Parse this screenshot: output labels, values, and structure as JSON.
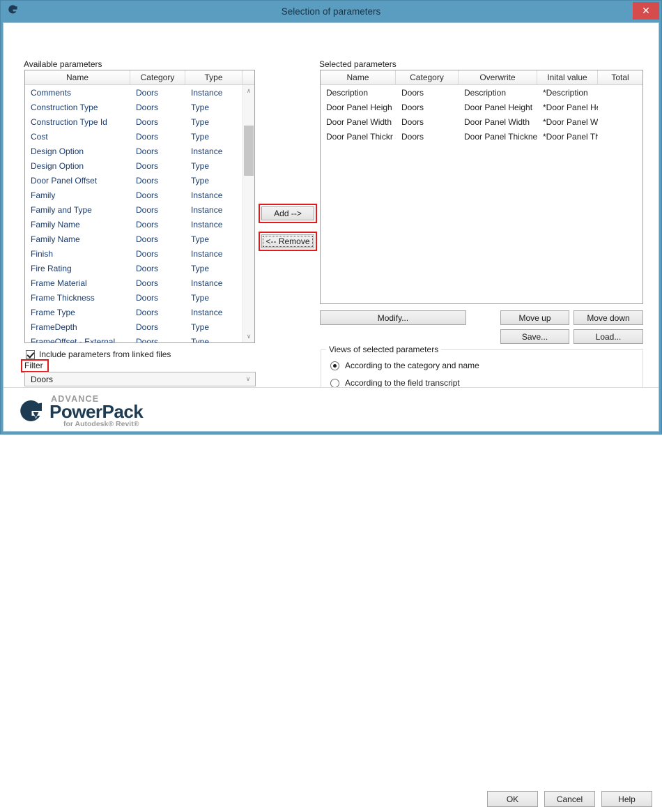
{
  "window": {
    "title": "Selection of parameters",
    "icon": "graitec-g-icon",
    "close_label": "✕",
    "titlebar_color": "#5b9dc0",
    "close_color": "#d64c4c",
    "highlight_color": "#e01b1b"
  },
  "available": {
    "label": "Available parameters",
    "columns": [
      "Name",
      "Category",
      "Type"
    ],
    "rows": [
      {
        "name": "Comments",
        "category": "Doors",
        "type": "Instance"
      },
      {
        "name": "Construction Type",
        "category": "Doors",
        "type": "Type"
      },
      {
        "name": "Construction Type Id",
        "category": "Doors",
        "type": "Type"
      },
      {
        "name": "Cost",
        "category": "Doors",
        "type": "Type"
      },
      {
        "name": "Design Option",
        "category": "Doors",
        "type": "Instance"
      },
      {
        "name": "Design Option",
        "category": "Doors",
        "type": "Type"
      },
      {
        "name": "Door Panel Offset",
        "category": "Doors",
        "type": "Type"
      },
      {
        "name": "Family",
        "category": "Doors",
        "type": "Instance"
      },
      {
        "name": "Family and Type",
        "category": "Doors",
        "type": "Instance"
      },
      {
        "name": "Family Name",
        "category": "Doors",
        "type": "Instance"
      },
      {
        "name": "Family Name",
        "category": "Doors",
        "type": "Type"
      },
      {
        "name": "Finish",
        "category": "Doors",
        "type": "Instance"
      },
      {
        "name": "Fire Rating",
        "category": "Doors",
        "type": "Type"
      },
      {
        "name": "Frame Material",
        "category": "Doors",
        "type": "Instance"
      },
      {
        "name": "Frame Thickness",
        "category": "Doors",
        "type": "Type"
      },
      {
        "name": "Frame Type",
        "category": "Doors",
        "type": "Instance"
      },
      {
        "name": "FrameDepth",
        "category": "Doors",
        "type": "Type"
      },
      {
        "name": "FrameOffset - External",
        "category": "Doors",
        "type": "Type"
      }
    ],
    "scroll_up_glyph": "∧",
    "scroll_down_glyph": "∨"
  },
  "selected": {
    "label": "Selected parameters",
    "columns": [
      "Name",
      "Category",
      "Overwrite",
      "Inital value",
      "Total"
    ],
    "rows": [
      {
        "name": "Description",
        "category": "Doors",
        "overwrite": "Description",
        "initial": "*Description",
        "total": ""
      },
      {
        "name": "Door Panel Heigh",
        "category": "Doors",
        "overwrite": "Door Panel Height",
        "initial": "*Door Panel He",
        "total": ""
      },
      {
        "name": "Door Panel Width",
        "category": "Doors",
        "overwrite": "Door Panel Width",
        "initial": "*Door Panel W",
        "total": ""
      },
      {
        "name": "Door Panel Thickr",
        "category": "Doors",
        "overwrite": "Door Panel Thickne",
        "initial": "*Door Panel Th",
        "total": ""
      }
    ]
  },
  "transfer": {
    "add_label": "Add -->",
    "remove_label": "<-- Remove"
  },
  "filter": {
    "include_linked_label": "Include parameters from linked files",
    "include_linked_checked": true,
    "filter_label": "Filter",
    "selected_value": "Doors",
    "dropdown_glyph": "∨"
  },
  "actions": {
    "modify_label": "Modify...",
    "move_up_label": "Move up",
    "move_down_label": "Move down",
    "save_label": "Save...",
    "load_label": "Load..."
  },
  "views_group": {
    "title": "Views of selected parameters",
    "options": [
      {
        "label": "According to the category and name",
        "selected": true
      },
      {
        "label": "According to the field transcript",
        "selected": false
      }
    ]
  },
  "branding": {
    "advance": "ADVANCE",
    "product": "PowerPack",
    "subtitle": "for Autodesk® Revit®"
  },
  "dialog_buttons": {
    "ok": "OK",
    "cancel": "Cancel",
    "help": "Help"
  }
}
